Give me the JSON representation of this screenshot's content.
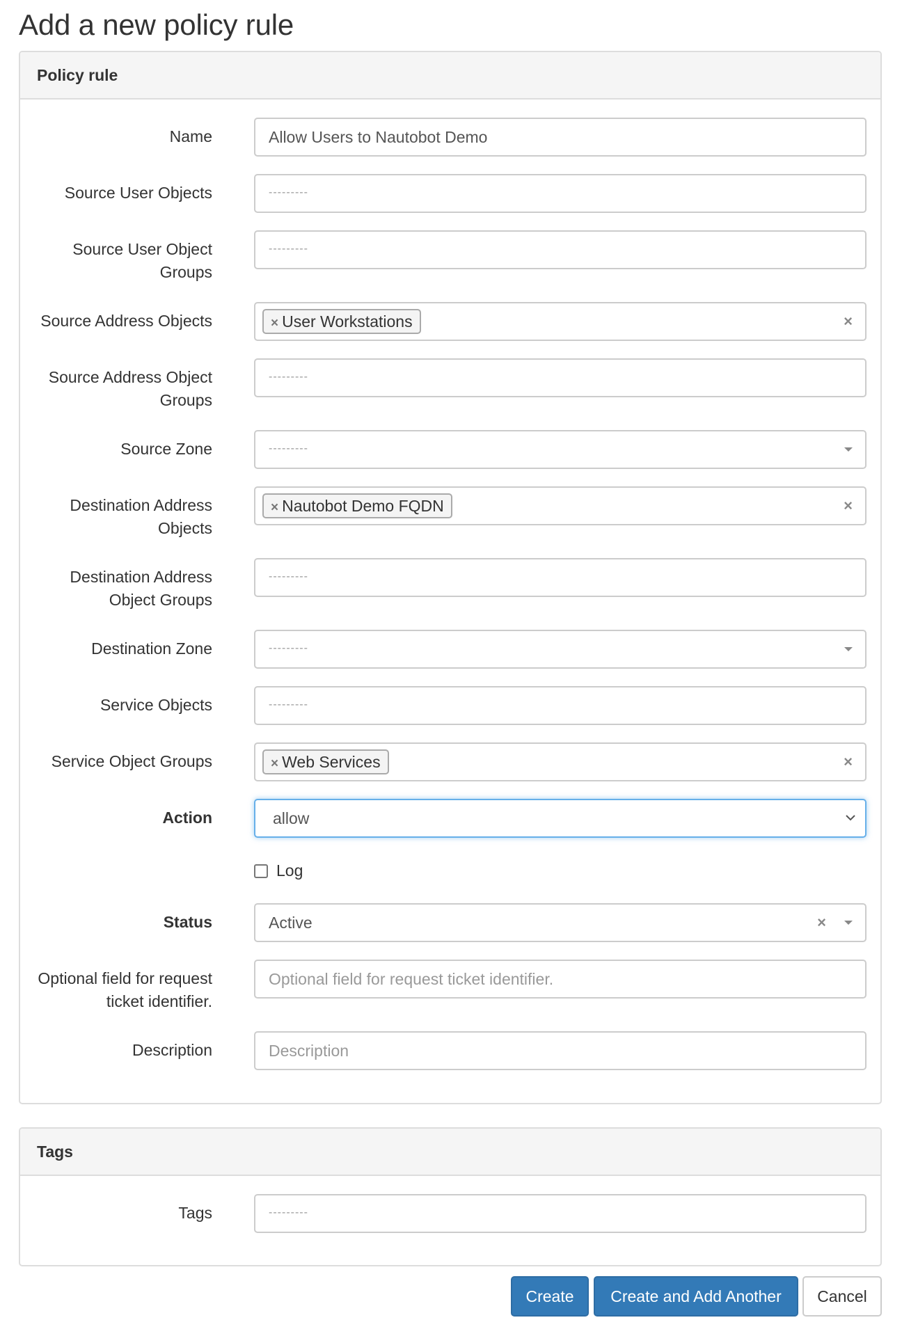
{
  "page": {
    "title": "Add a new policy rule"
  },
  "policy_panel": {
    "heading": "Policy rule",
    "fields": {
      "name": {
        "label": "Name",
        "value": "Allow Users to Nautobot Demo"
      },
      "source_user_objects": {
        "label": "Source User Objects",
        "placeholder": "---------"
      },
      "source_user_object_groups": {
        "label_line1": "Source User Object",
        "label_line2": "Groups",
        "placeholder": "---------"
      },
      "source_address_objects": {
        "label": "Source Address Objects",
        "chip": "User Workstations",
        "chip_remove": "×",
        "clear": "×"
      },
      "source_address_object_groups": {
        "label_line1": "Source Address Object",
        "label_line2": "Groups",
        "placeholder": "---------"
      },
      "source_zone": {
        "label": "Source Zone",
        "placeholder": "---------"
      },
      "destination_address_objects": {
        "label_line1": "Destination Address",
        "label_line2": "Objects",
        "chip": "Nautobot Demo FQDN",
        "chip_remove": "×",
        "clear": "×"
      },
      "destination_address_object_groups": {
        "label_line1": "Destination Address",
        "label_line2": "Object Groups",
        "placeholder": "---------"
      },
      "destination_zone": {
        "label": "Destination Zone",
        "placeholder": "---------"
      },
      "service_objects": {
        "label": "Service Objects",
        "placeholder": "---------"
      },
      "service_object_groups": {
        "label": "Service Object Groups",
        "chip": "Web Services",
        "chip_remove": "×",
        "clear": "×"
      },
      "action": {
        "label": "Action",
        "value": "allow"
      },
      "log": {
        "label": "Log",
        "checked": false
      },
      "status": {
        "label": "Status",
        "value": "Active",
        "clear": "×"
      },
      "request_id": {
        "label_line1": "Optional field for request",
        "label_line2": "ticket identifier.",
        "placeholder": "Optional field for request ticket identifier."
      },
      "description": {
        "label": "Description",
        "placeholder": "Description"
      }
    }
  },
  "tags_panel": {
    "heading": "Tags",
    "tags": {
      "label": "Tags",
      "placeholder": "---------"
    }
  },
  "buttons": {
    "create": "Create",
    "create_and_add": "Create and Add Another",
    "cancel": "Cancel"
  },
  "colors": {
    "primary": "#337ab7",
    "focus_border": "#66afe9",
    "panel_heading_bg": "#f5f5f5"
  }
}
